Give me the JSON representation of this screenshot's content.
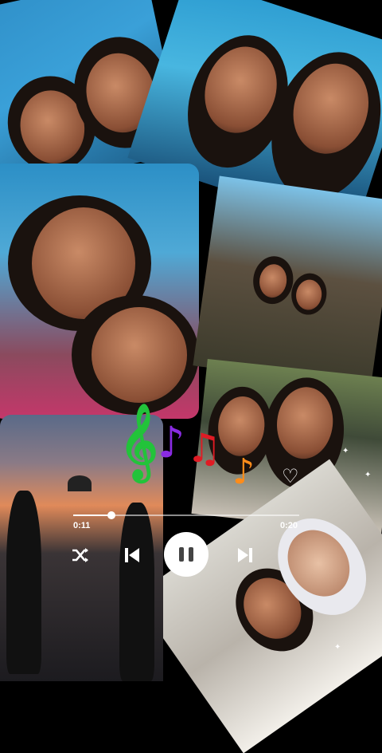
{
  "player": {
    "elapsed": "0:11",
    "duration": "0:20",
    "progress": 0.17
  },
  "controls": {
    "shuffle_icon": "shuffle-icon",
    "previous_icon": "skip-previous-icon",
    "pause_icon": "pause-icon",
    "next_icon": "skip-next-icon"
  },
  "decor": {
    "notes": [
      "𝄞",
      "♪",
      "♫",
      "♪"
    ],
    "note_colors": [
      "#22c33a",
      "#8a2be2",
      "#e01b24",
      "#ff8c1a"
    ]
  }
}
